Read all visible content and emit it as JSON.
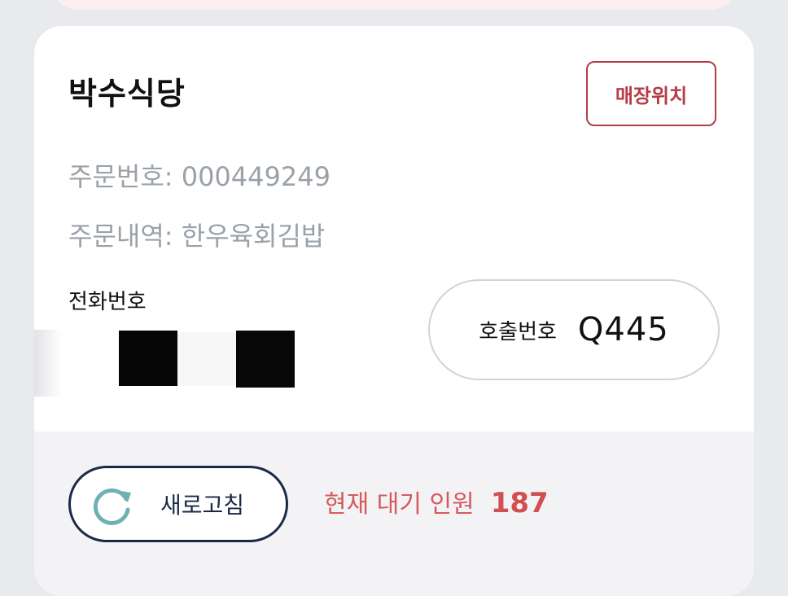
{
  "store": {
    "name": "박수식당",
    "location_button": "매장위치"
  },
  "order": {
    "number_text": "주문번호: 000449249",
    "items_text": "주문내역: 한우육회김밥"
  },
  "phone": {
    "label": "전화번호"
  },
  "call": {
    "label": "호출번호",
    "value": "Q445"
  },
  "footer": {
    "refresh_label": "새로고침",
    "waiting_label": "현재 대기 인원",
    "waiting_count": "187"
  },
  "colors": {
    "accent": "#b53c47",
    "waiting": "#d65a5d",
    "navy": "#1a2a44",
    "refresh_icon": "#6fb0b4",
    "muted_text": "#9aa1a8"
  },
  "icons": {
    "refresh": "refresh-icon"
  }
}
